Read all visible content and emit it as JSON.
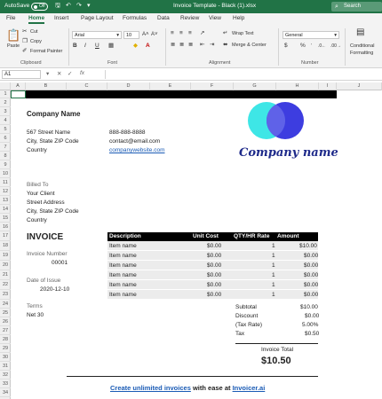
{
  "titlebar": {
    "autosave_label": "AutoSave",
    "toggle_state": "Off",
    "doc_title": "Invoice Template - Black (1).xlsx",
    "search_placeholder": "Search"
  },
  "tabs": [
    "File",
    "Home",
    "Insert",
    "Page Layout",
    "Formulas",
    "Data",
    "Review",
    "View",
    "Help"
  ],
  "active_tab": "Home",
  "ribbon": {
    "clipboard": {
      "paste": "Paste",
      "cut": "Cut",
      "copy": "Copy",
      "format_painter": "Format Painter",
      "label": "Clipboard"
    },
    "font": {
      "name": "Arial",
      "size": "10",
      "label": "Font"
    },
    "alignment": {
      "wrap_text": "Wrap Text",
      "merge_center": "Merge & Center",
      "label": "Alignment"
    },
    "number": {
      "format": "General",
      "label": "Number"
    },
    "styles": {
      "conditional_formatting_1": "Conditional",
      "conditional_formatting_2": "Formatting"
    }
  },
  "formula_bar": {
    "name_box": "A1",
    "fx": "fx"
  },
  "columns": [
    "A",
    "B",
    "C",
    "D",
    "E",
    "F",
    "G",
    "H",
    "I",
    "J"
  ],
  "rows": [
    "1",
    "2",
    "3",
    "4",
    "5",
    "6",
    "7",
    "8",
    "9",
    "10",
    "11",
    "12",
    "13",
    "14",
    "15",
    "16",
    "17",
    "18",
    "19",
    "20",
    "21",
    "22",
    "23",
    "24",
    "25",
    "26",
    "27",
    "28",
    "29",
    "30",
    "31",
    "32",
    "33",
    "34",
    "35",
    "36"
  ],
  "invoice": {
    "company_name": "Company Name",
    "street": "567 Street Name",
    "city": "City, State ZIP Code",
    "country": "Country",
    "phone": "888-888-8888",
    "email": "contact@email.com",
    "website": "companywebsite.com",
    "logo_text": "Company name",
    "logo_colors": {
      "left": "#3ee6e6",
      "right": "#3d3de0",
      "overlap": "#5f62e8",
      "text": "#1e2a8a"
    },
    "billed_to_label": "Billed To",
    "client": "Your Client",
    "client_street": "Street Address",
    "client_city": "City, State ZIP Code",
    "client_country": "Country",
    "title": "INVOICE",
    "invoice_number_label": "Invoice Number",
    "invoice_number": "00001",
    "date_label": "Date of Issue",
    "date": "2020-12-10",
    "terms_label": "Terms",
    "terms": "Net 30",
    "table_headers": [
      "Description",
      "Unit Cost",
      "QTY/HR Rate",
      "Amount"
    ],
    "items": [
      {
        "desc": "Item name",
        "cost": "$0.00",
        "qty": "1",
        "amount": "$10.00"
      },
      {
        "desc": "Item name",
        "cost": "$0.00",
        "qty": "1",
        "amount": "$0.00"
      },
      {
        "desc": "Item name",
        "cost": "$0.00",
        "qty": "1",
        "amount": "$0.00"
      },
      {
        "desc": "Item name",
        "cost": "$0.00",
        "qty": "1",
        "amount": "$0.00"
      },
      {
        "desc": "Item name",
        "cost": "$0.00",
        "qty": "1",
        "amount": "$0.00"
      },
      {
        "desc": "Item name",
        "cost": "$0.00",
        "qty": "1",
        "amount": "$0.00"
      }
    ],
    "subtotal_label": "Subtotal",
    "subtotal": "$10.00",
    "discount_label": "Discount",
    "discount": "$0.00",
    "tax_rate_label": "(Tax Rate)",
    "tax_rate": "5.00%",
    "tax_label": "Tax",
    "tax": "$0.50",
    "total_label": "Invoice Total",
    "total": "$10.50",
    "footer_link": "Create unlimited invoices",
    "footer_mid": "with ease at",
    "footer_site": "Invoicer.ai"
  },
  "colors": {
    "excel_green": "#217346",
    "link_blue": "#1a5bb5"
  }
}
